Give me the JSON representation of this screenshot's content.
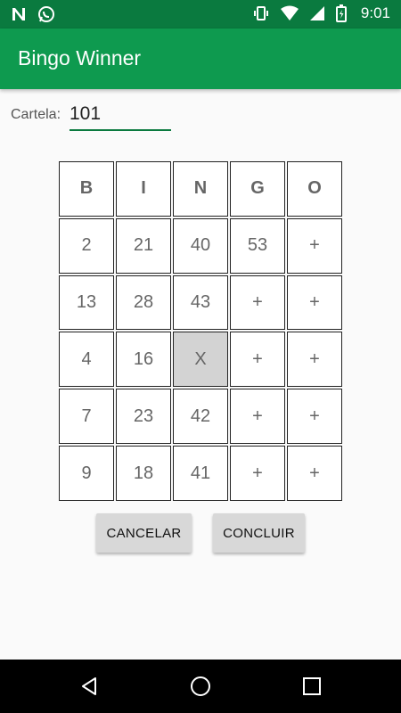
{
  "status_bar": {
    "time": "9:01",
    "icons": [
      "n-notification-icon",
      "whatsapp-icon",
      "vibrate-icon",
      "wifi-icon",
      "signal-icon",
      "battery-icon"
    ]
  },
  "app_bar": {
    "title": "Bingo Winner"
  },
  "form": {
    "cartela_label": "Cartela:",
    "cartela_value": "101"
  },
  "bingo": {
    "headers": [
      "B",
      "I",
      "N",
      "G",
      "O"
    ],
    "rows": [
      [
        "2",
        "21",
        "40",
        "53",
        "+"
      ],
      [
        "13",
        "28",
        "43",
        "+",
        "+"
      ],
      [
        "4",
        "16",
        "X",
        "+",
        "+"
      ],
      [
        "7",
        "23",
        "42",
        "+",
        "+"
      ],
      [
        "9",
        "18",
        "41",
        "+",
        "+"
      ]
    ]
  },
  "buttons": {
    "cancel_label": "CANCELAR",
    "conclude_label": "CONCLUIR"
  },
  "nav_bar": {
    "icons": [
      "back-icon",
      "home-icon",
      "recents-icon"
    ]
  },
  "colors": {
    "status_bar": "#0a7a3f",
    "app_bar": "#0e9a4f",
    "free_cell": "#d3d3d3"
  }
}
